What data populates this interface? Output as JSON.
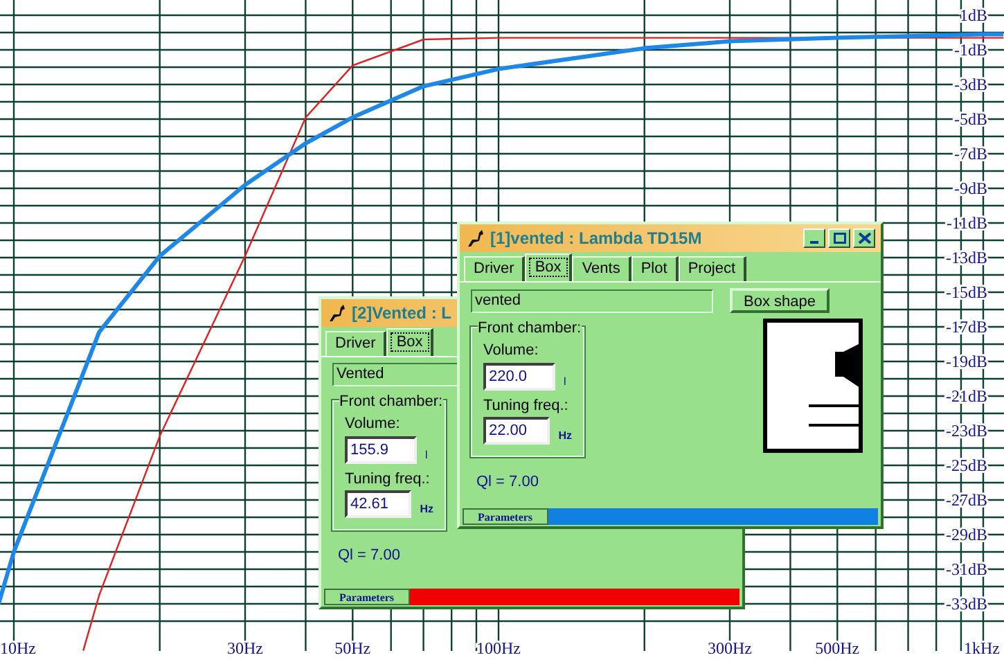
{
  "plot": {
    "x_labels": [
      "10Hz",
      "30Hz",
      "50Hz",
      "100Hz",
      "300Hz",
      "500Hz",
      "1kHz"
    ],
    "y_labels": [
      "1dB",
      "-1dB",
      "-3dB",
      "-5dB",
      "-7dB",
      "-9dB",
      "-11dB",
      "-13dB",
      "-15dB",
      "-17dB",
      "-19dB",
      "-21dB",
      "-23dB",
      "-25dB",
      "-27dB",
      "-29dB",
      "-31dB",
      "-33dB"
    ]
  },
  "windows": [
    {
      "title": "[2]Vented : L",
      "tabs": [
        {
          "label": "Driver",
          "selected": false
        },
        {
          "label": "Box",
          "selected": true
        }
      ],
      "box_type": "Vented",
      "group": "Front chamber:",
      "volume_label": "Volume:",
      "volume": "155.9",
      "volume_unit": "l",
      "tuning_label": "Tuning freq.:",
      "tuning": "42.61",
      "tuning_unit": "Hz",
      "ql": "Ql = 7.00",
      "status_label": "Parameters",
      "color": "#f00000"
    },
    {
      "title": "[1]vented : Lambda TD15M",
      "controls": true,
      "tabs": [
        {
          "label": "Driver",
          "selected": false
        },
        {
          "label": "Box",
          "selected": true
        },
        {
          "label": "Vents",
          "selected": false
        },
        {
          "label": "Plot",
          "selected": false
        },
        {
          "label": "Project",
          "selected": false
        }
      ],
      "box_type": "vented",
      "box_shape_button": "Box shape",
      "group": "Front chamber:",
      "volume_label": "Volume:",
      "volume": "220.0",
      "volume_unit": "l",
      "tuning_label": "Tuning freq.:",
      "tuning": "22.00",
      "tuning_unit": "Hz",
      "ql": "Ql = 7.00",
      "status_label": "Parameters",
      "color": "#1080e0"
    }
  ]
}
